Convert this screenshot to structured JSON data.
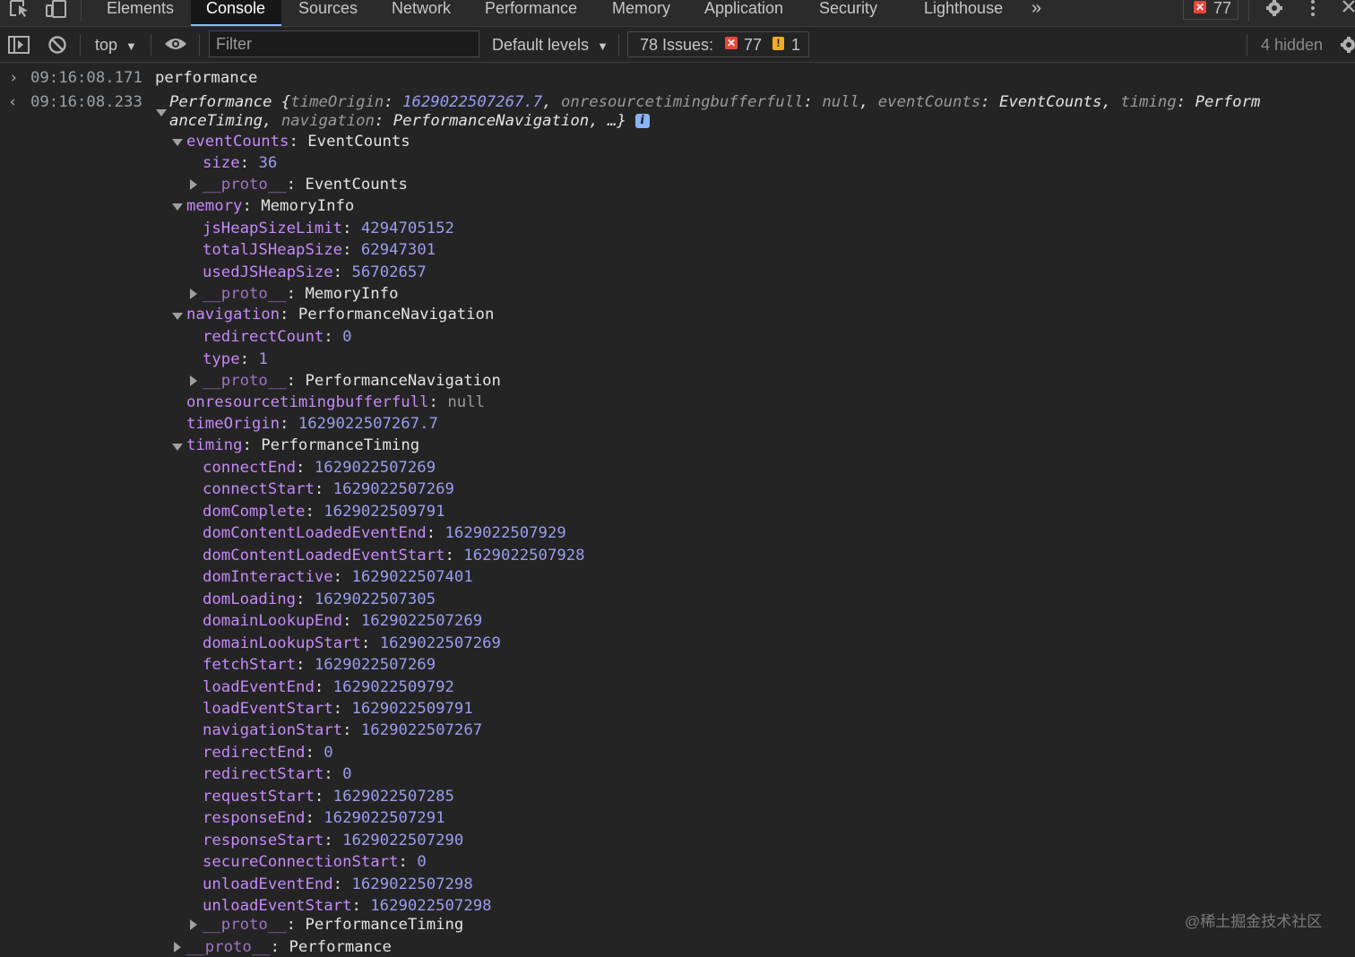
{
  "tabs": [
    "Elements",
    "Console",
    "Sources",
    "Network",
    "Performance",
    "Memory",
    "Application",
    "Security",
    "Lighthouse"
  ],
  "active_tab": "Console",
  "tab_overflow_icon": "double-chevron-right-icon",
  "error_count": "77",
  "toolbar": {
    "context": "top",
    "filter_placeholder": "Filter",
    "levels": "Default levels",
    "issues_label": "78 Issues:",
    "issues_errors": "77",
    "issues_warnings": "1",
    "hidden": "4 hidden"
  },
  "console": {
    "input_ts": "09:16:08.171",
    "input_cmd": "performance",
    "output_ts": "09:16:08.233",
    "summary": {
      "name": "Performance",
      "open": "{",
      "k1": "timeOrigin",
      "v1": "1629022507267.7",
      "k2": "onresourcetimingbufferfull",
      "v2": "null",
      "k3": "eventCounts",
      "v3": "EventCounts",
      "k4": "timing",
      "v4a": "Perform",
      "v4b": "anceTiming",
      "k5": "navigation",
      "v5": "PerformanceNavigation",
      "tail": "…}"
    },
    "eventCounts": {
      "label": "eventCounts",
      "type": "EventCounts",
      "size_key": "size",
      "size": "36",
      "proto": "EventCounts"
    },
    "memory": {
      "label": "memory",
      "type": "MemoryInfo",
      "items": [
        {
          "k": "jsHeapSizeLimit",
          "v": "4294705152"
        },
        {
          "k": "totalJSHeapSize",
          "v": "62947301"
        },
        {
          "k": "usedJSHeapSize",
          "v": "56702657"
        }
      ],
      "proto": "MemoryInfo"
    },
    "navigation": {
      "label": "navigation",
      "type": "PerformanceNavigation",
      "items": [
        {
          "k": "redirectCount",
          "v": "0"
        },
        {
          "k": "type",
          "v": "1"
        }
      ],
      "proto": "PerformanceNavigation"
    },
    "onres": {
      "k": "onresourcetimingbufferfull",
      "v": "null"
    },
    "timeOrigin": {
      "k": "timeOrigin",
      "v": "1629022507267.7"
    },
    "timing": {
      "label": "timing",
      "type": "PerformanceTiming",
      "items": [
        {
          "k": "connectEnd",
          "v": "1629022507269"
        },
        {
          "k": "connectStart",
          "v": "1629022507269"
        },
        {
          "k": "domComplete",
          "v": "1629022509791"
        },
        {
          "k": "domContentLoadedEventEnd",
          "v": "1629022507929"
        },
        {
          "k": "domContentLoadedEventStart",
          "v": "1629022507928"
        },
        {
          "k": "domInteractive",
          "v": "1629022507401"
        },
        {
          "k": "domLoading",
          "v": "1629022507305"
        },
        {
          "k": "domainLookupEnd",
          "v": "1629022507269"
        },
        {
          "k": "domainLookupStart",
          "v": "1629022507269"
        },
        {
          "k": "fetchStart",
          "v": "1629022507269"
        },
        {
          "k": "loadEventEnd",
          "v": "1629022509792"
        },
        {
          "k": "loadEventStart",
          "v": "1629022509791"
        },
        {
          "k": "navigationStart",
          "v": "1629022507267"
        },
        {
          "k": "redirectEnd",
          "v": "0"
        },
        {
          "k": "redirectStart",
          "v": "0"
        },
        {
          "k": "requestStart",
          "v": "1629022507285"
        },
        {
          "k": "responseEnd",
          "v": "1629022507291"
        },
        {
          "k": "responseStart",
          "v": "1629022507290"
        },
        {
          "k": "secureConnectionStart",
          "v": "0"
        },
        {
          "k": "unloadEventEnd",
          "v": "1629022507298"
        },
        {
          "k": "unloadEventStart",
          "v": "1629022507298"
        }
      ],
      "proto": "PerformanceTiming"
    },
    "proto_key": "__proto__",
    "root_proto": "Performance"
  },
  "watermark": "@稀土掘金技术社区"
}
